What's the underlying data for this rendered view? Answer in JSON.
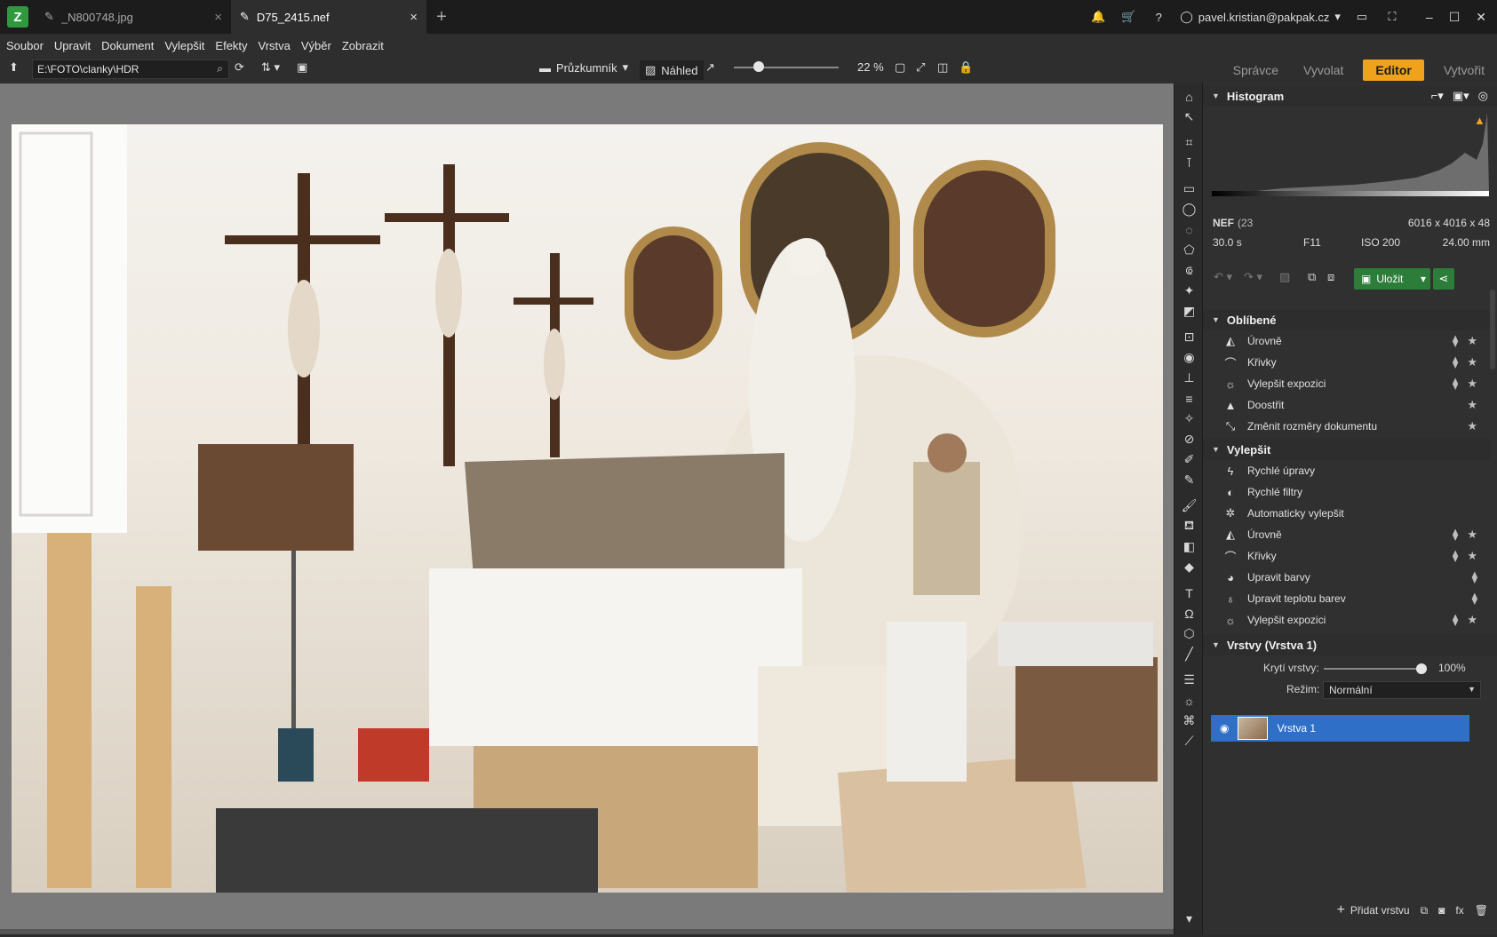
{
  "tabs": [
    {
      "label": "_N800748.jpg",
      "active": false
    },
    {
      "label": "D75_2415.nef",
      "active": true
    }
  ],
  "user": {
    "email": "pavel.kristian@pakpak.cz"
  },
  "menu": [
    "Soubor",
    "Upravit",
    "Dokument",
    "Vylepšit",
    "Efekty",
    "Vrstva",
    "Výběr",
    "Zobrazit"
  ],
  "toolbar": {
    "path": "E:\\FOTO\\clanky\\HDR",
    "explorer_label": "Průzkumník",
    "preview_label": "Náhled",
    "zoom": "22 %",
    "zoom_level": 0.22
  },
  "modes": [
    {
      "label": "Správce",
      "active": false
    },
    {
      "label": "Vyvolat",
      "active": false
    },
    {
      "label": "Editor",
      "active": true
    },
    {
      "label": "Vytvořit",
      "active": false
    }
  ],
  "histogram": {
    "title": "Histogram",
    "format": "NEF",
    "format_detail": "(23",
    "dimensions": "6016 x 4016 x 48",
    "shutter": "30.0 s",
    "aperture": "F11",
    "iso": "ISO 200",
    "focal": "24.00 mm"
  },
  "actions": {
    "save_label": "Uložit"
  },
  "favorites": {
    "title": "Oblíbené",
    "items": [
      "Úrovně",
      "Křivky",
      "Vylepšit expozici",
      "Doostřit",
      "Změnit rozměry dokumentu"
    ]
  },
  "improve": {
    "title": "Vylepšit",
    "items": [
      "Rychlé úpravy",
      "Rychlé filtry",
      "Automaticky vylepšit",
      "Úrovně",
      "Křivky",
      "Upravit barvy",
      "Upravit teplotu barev",
      "Vylepšit expozici"
    ]
  },
  "layers": {
    "title": "Vrstvy (Vrstva 1)",
    "opacity_label": "Krytí vrstvy:",
    "opacity_value": "100%",
    "mode_label": "Režim:",
    "mode_value": "Normální",
    "layer_name": "Vrstva 1",
    "add_layer_label": "Přidat vrstvu"
  }
}
